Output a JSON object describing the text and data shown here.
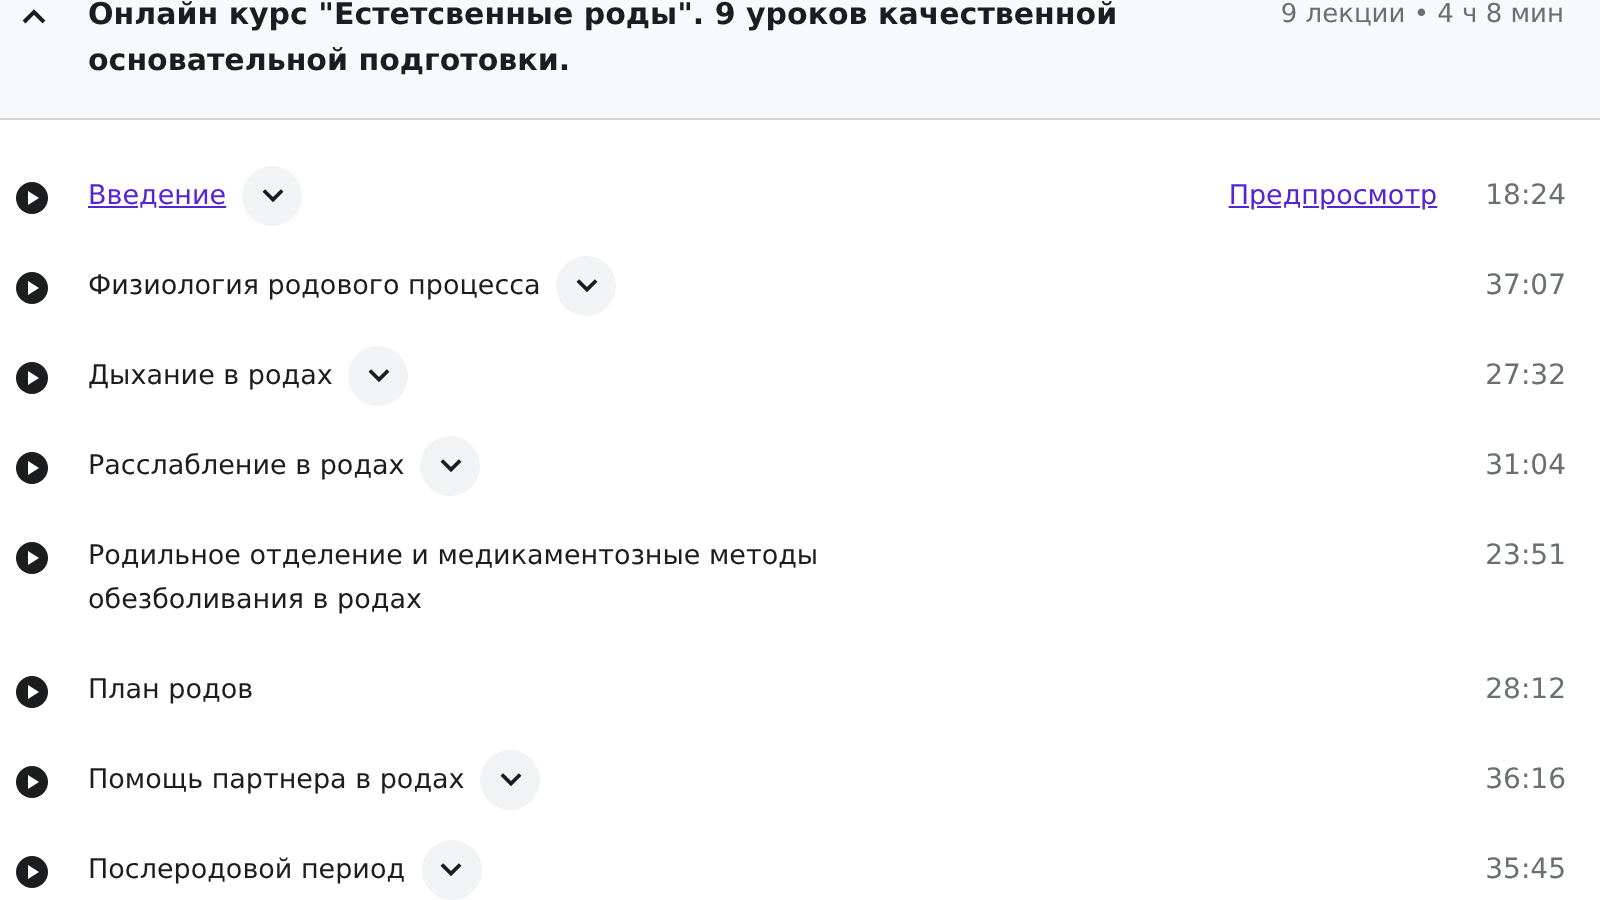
{
  "section": {
    "title": "Онлайн курс \"Естетсвенные роды\". 9 уроков качественной основательной подготовки.",
    "expanded": true,
    "meta": "9 лекции • 4 ч 8 мин"
  },
  "lectures": [
    {
      "title": "Введение",
      "link": true,
      "expandable": true,
      "preview": "Предпросмотр",
      "duration": "18:24"
    },
    {
      "title": "Физиология родового процесса",
      "link": false,
      "expandable": true,
      "duration": "37:07"
    },
    {
      "title": "Дыхание в родах",
      "link": false,
      "expandable": true,
      "duration": "27:32"
    },
    {
      "title": "Расслабление в родах",
      "link": false,
      "expandable": true,
      "duration": "31:04"
    },
    {
      "title": "Родильное отделение и медикаментозные методы обезболивания в родах",
      "link": false,
      "expandable": false,
      "duration": "23:51"
    },
    {
      "title": "План родов",
      "link": false,
      "expandable": false,
      "duration": "28:12"
    },
    {
      "title": "Помощь партнера в родах",
      "link": false,
      "expandable": true,
      "duration": "36:16"
    },
    {
      "title": "Послеродовой период",
      "link": false,
      "expandable": true,
      "duration": "35:45"
    }
  ]
}
